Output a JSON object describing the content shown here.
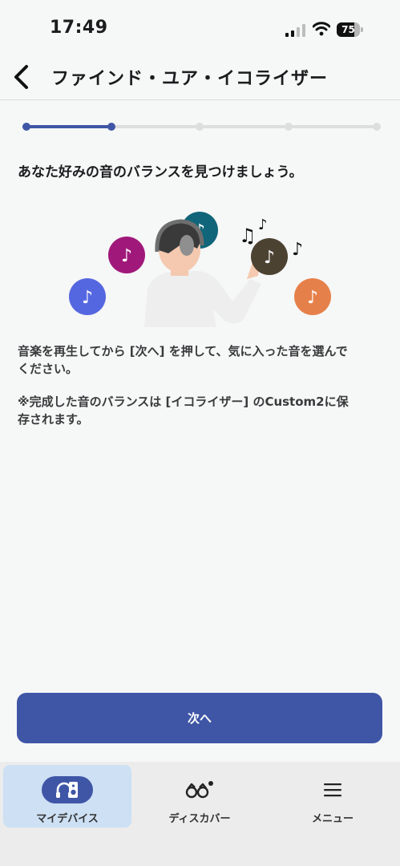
{
  "status_bar": {
    "time": "17:49",
    "battery_level": "75",
    "battery_fraction": 0.75
  },
  "nav": {
    "title": "ファインド・ユア・イコライザー",
    "back_icon": "chevron-left-icon"
  },
  "progress": {
    "current_step": 2,
    "total_steps": 5,
    "fraction": 0.25
  },
  "main": {
    "heading": "あなた好みの音のバランスを見つけましょう。",
    "instruction_line1": "音楽を再生してから [次へ] を押して、気に入った音を選んで",
    "instruction_line2": "ください。",
    "note_line1": "※完成した音のバランスは [イコライザー] のCustom2に保",
    "note_line2": "存されます。",
    "illustration_colors": {
      "blue": "#5567e0",
      "magenta": "#a0197a",
      "teal": "#10657a",
      "dark": "#4c4232",
      "orange": "#e6804a"
    }
  },
  "primary_button": {
    "label": "次へ"
  },
  "tab_bar": {
    "tabs": [
      {
        "label": "マイデバイス",
        "icon": "headphones-speaker-icon",
        "selected": true
      },
      {
        "label": "ディスカバー",
        "icon": "binoculars-icon",
        "selected": false,
        "badge": true
      },
      {
        "label": "メニュー",
        "icon": "hamburger-menu-icon",
        "selected": false
      }
    ]
  },
  "colors": {
    "accent": "#3f56a6",
    "selected_tab_bg": "#cde0f4",
    "background": "#f6f7f7"
  }
}
